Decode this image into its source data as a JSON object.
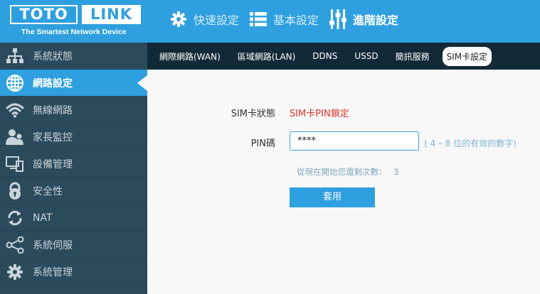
{
  "brand": {
    "logo_left": "TOTO",
    "logo_right": "LINK",
    "tagline": "The Smartest Network Device"
  },
  "topnav": [
    {
      "label": "快速設定",
      "icon": "gear-icon"
    },
    {
      "label": "基本設定",
      "icon": "list-icon"
    },
    {
      "label": "進階設定",
      "icon": "sliders-icon"
    }
  ],
  "sidebar": [
    {
      "label": "系統狀態",
      "icon": "network-status-icon"
    },
    {
      "label": "網路設定",
      "icon": "globe-icon"
    },
    {
      "label": "無線網路",
      "icon": "wifi-icon"
    },
    {
      "label": "家長監控",
      "icon": "parental-control-icon"
    },
    {
      "label": "設備管理",
      "icon": "device-icon"
    },
    {
      "label": "安全性",
      "icon": "lock-icon"
    },
    {
      "label": "NAT",
      "icon": "refresh-icon"
    },
    {
      "label": "系統伺服",
      "icon": "share-icon"
    },
    {
      "label": "系統管理",
      "icon": "gear-icon"
    }
  ],
  "subnav": [
    "網際網路(WAN)",
    "區域網路(LAN)",
    "DDNS",
    "USSD",
    "簡訊服務",
    "SIM卡設定"
  ],
  "form": {
    "sim_status_label": "SIM卡狀態",
    "sim_status_value": "SIM卡PIN鎖定",
    "pin_label": "PIN碼",
    "pin_value": "****",
    "pin_hint": "( 4 – 8 位的有效的數字)",
    "remaining_label": "從現在開始您還剩次數：",
    "remaining_value": "3",
    "apply_label": "套用"
  },
  "colors": {
    "header": "#2fa0df",
    "sidebar": "#2b4a5b",
    "subnav": "#122a38",
    "status_red": "#d9362b"
  }
}
